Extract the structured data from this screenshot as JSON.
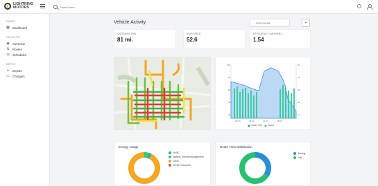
{
  "header": {
    "logo_text": "LIGHTNING MOTORS",
    "search_placeholder": "Search here..."
  },
  "sidebar": {
    "sections": [
      {
        "title": "CHART",
        "items": [
          {
            "label": "Dashboard",
            "icon": "dashboard-icon"
          }
        ]
      },
      {
        "title": "VEHICLES",
        "items": [
          {
            "label": "Overview",
            "icon": "overview-icon"
          },
          {
            "label": "Routes",
            "icon": "routes-icon"
          },
          {
            "label": "Schedules",
            "icon": "schedules-icon"
          }
        ]
      },
      {
        "title": "DEPOT",
        "items": [
          {
            "label": "Depots",
            "icon": "depot-icon"
          },
          {
            "label": "Chargers",
            "icon": "charger-icon"
          }
        ]
      }
    ]
  },
  "main": {
    "title": "Vehicle Activity",
    "date_value": "2022-09-05",
    "stats": [
      {
        "label": "DISTANCE (MI)",
        "value": "81 mi."
      },
      {
        "label": "KWH USED",
        "value": "52.6"
      },
      {
        "label": "EFFICIENCY (MI/KWH)",
        "value": "1.54"
      }
    ],
    "charts": {
      "line_legend": [
        "Instant SOC",
        "Speed"
      ],
      "energy_title": "Energy Usage",
      "energy_legend": [
        "HVAC",
        "Battery Thermal Management",
        "Drive",
        "DCDC Converter"
      ],
      "route_title": "Route Time Distribution",
      "route_legend": [
        "Driving",
        "Idle"
      ]
    }
  },
  "colors": {
    "hvac": "#29a3d8",
    "btm": "#2ecc71",
    "drive": "#f5a623",
    "dcdc": "#e84c5a",
    "driving": "#2a8fd6",
    "idle": "#27c26f",
    "soc": "#3a8ee6",
    "speed": "#2ecc9a"
  }
}
